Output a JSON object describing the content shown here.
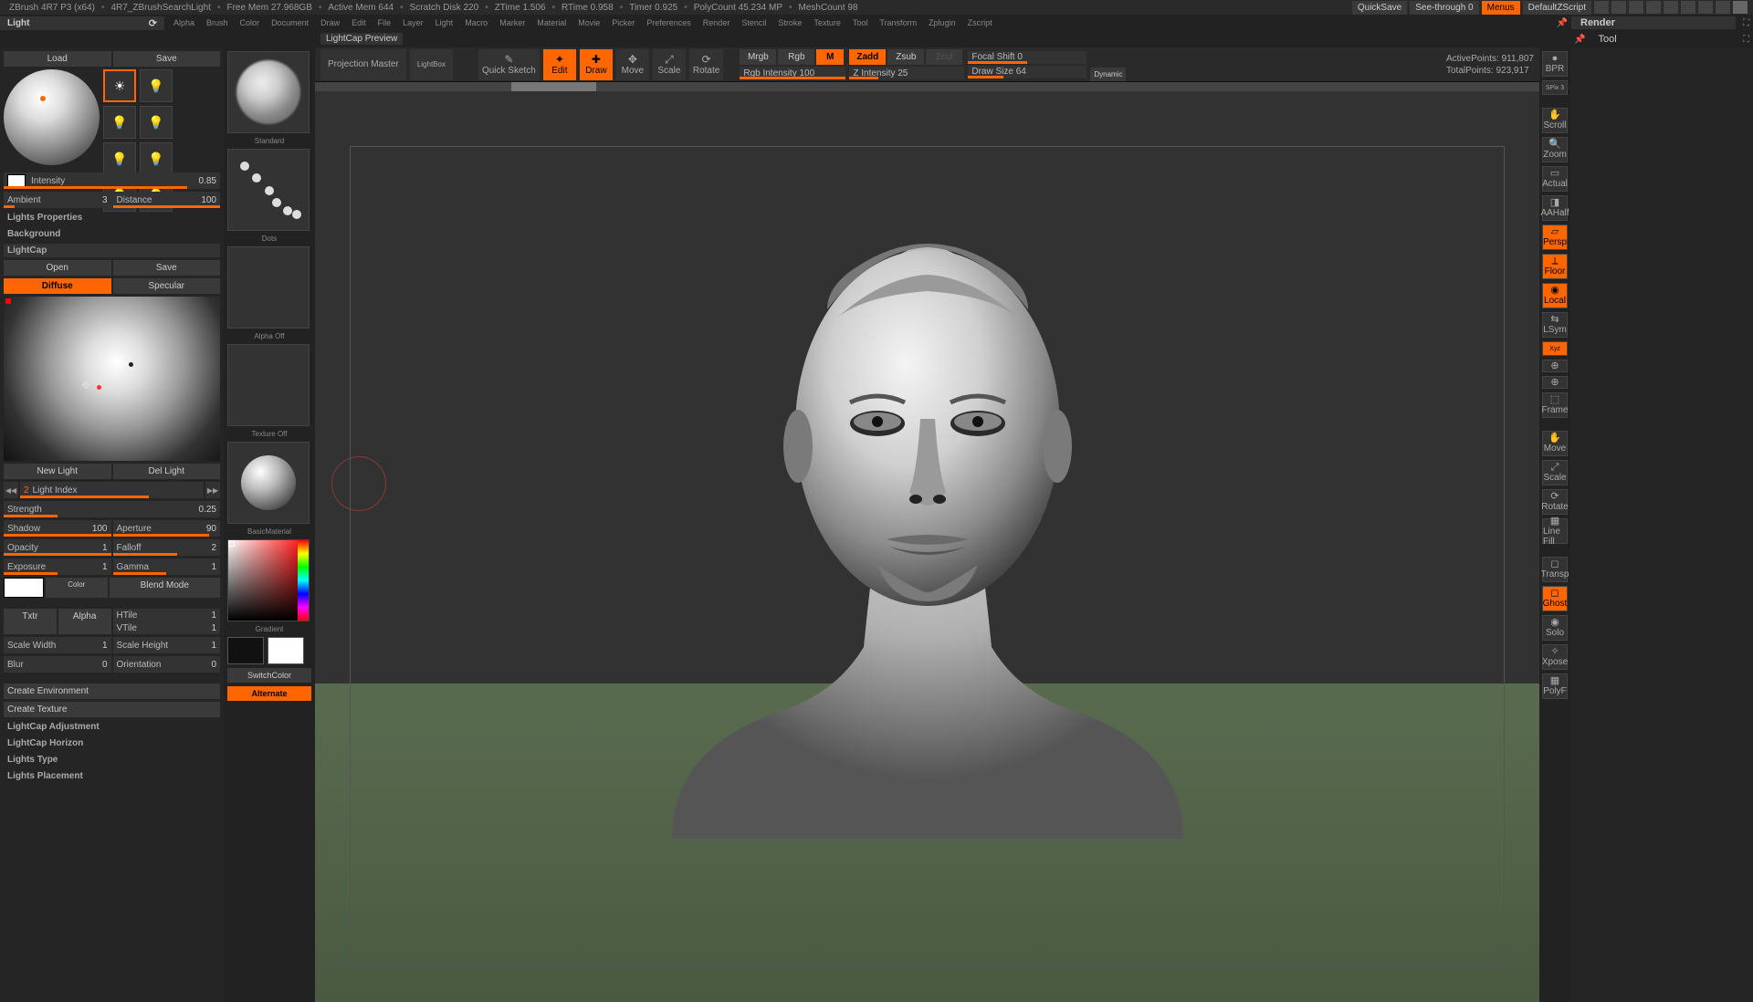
{
  "status": {
    "app": "ZBrush 4R7 P3 (x64)",
    "doc": "4R7_ZBrushSearchLight",
    "freemem": "Free Mem 27.968GB",
    "activemem": "Active Mem 644",
    "scratch": "Scratch Disk 220",
    "ztime": "ZTime 1.506",
    "rtime": "RTime 0.958",
    "timer": "Timer 0.925",
    "polycount": "PolyCount 45.234 MP",
    "meshcount": "MeshCount 98",
    "quicksave": "QuickSave",
    "seethrough": "See-through   0",
    "menus": "Menus",
    "defaultscript": "DefaultZScript"
  },
  "palette_title": "Light",
  "menus": [
    "Alpha",
    "Brush",
    "Color",
    "Document",
    "Draw",
    "Edit",
    "File",
    "Layer",
    "Light",
    "Macro",
    "Marker",
    "Material",
    "Movie",
    "Picker",
    "Preferences",
    "Render",
    "Stencil",
    "Stroke",
    "Texture",
    "Tool",
    "Transform",
    "Zplugin",
    "Zscript"
  ],
  "render": "Render",
  "tool": "Tool",
  "left": {
    "load": "Load",
    "save": "Save",
    "intensity_lab": "Intensity",
    "intensity_val": "0.85",
    "ambient_lab": "Ambient",
    "ambient_val": "3",
    "distance_lab": "Distance",
    "distance_val": "100",
    "lights_props": "Lights Properties",
    "background": "Background",
    "lightcap": "LightCap",
    "open": "Open",
    "lc_save": "Save",
    "diffuse": "Diffuse",
    "specular": "Specular",
    "new_light": "New Light",
    "del_light": "Del Light",
    "light_index_lab": "Light Index",
    "light_index_val": "2",
    "strength_lab": "Strength",
    "strength_val": "0.25",
    "shadow_lab": "Shadow",
    "shadow_val": "100",
    "aperture_lab": "Aperture",
    "aperture_val": "90",
    "opacity_lab": "Opacity",
    "opacity_val": "1",
    "falloff_lab": "Falloff",
    "falloff_val": "2",
    "exposure_lab": "Exposure",
    "exposure_val": "1",
    "gamma_lab": "Gamma",
    "gamma_val": "1",
    "color": "Color",
    "blend": "Blend Mode",
    "txtr": "Txtr",
    "alpha": "Alpha",
    "htile_lab": "HTile",
    "htile_val": "1",
    "vtile_lab": "VTile",
    "vtile_val": "1",
    "scalew_lab": "Scale Width",
    "scalew_val": "1",
    "scaleh_lab": "Scale Height",
    "scaleh_val": "1",
    "blur_lab": "Blur",
    "blur_val": "0",
    "orient_lab": "Orientation",
    "orient_val": "0",
    "create_env": "Create Environment",
    "create_tex": "Create Texture",
    "lc_adjust": "LightCap Adjustment",
    "lc_horizon": "LightCap Horizon",
    "lights_type": "Lights Type",
    "lights_place": "Lights Placement"
  },
  "tray": {
    "brush": "Standard",
    "stroke": "Dots",
    "alpha": "Alpha Off",
    "texture": "Texture Off",
    "material": "BasicMaterial",
    "gradient": "Gradient",
    "switchcolor": "SwitchColor",
    "alternate": "Alternate"
  },
  "topbar": {
    "doc_title": "LightCap Preview",
    "projection": "Projection Master",
    "lightbox": "LightBox",
    "quicksketch": "Quick Sketch",
    "edit": "Edit",
    "draw": "Draw",
    "move": "Move",
    "scale": "Scale",
    "rotate": "Rotate",
    "mrgb": "Mrgb",
    "rgb": "Rgb",
    "m": "M",
    "rgb_int": "Rgb Intensity 100",
    "zadd": "Zadd",
    "zsub": "Zsub",
    "zcut": "Zcut",
    "z_int": "Z Intensity 25",
    "focal": "Focal Shift 0",
    "drawsize": "Draw Size 64",
    "dynamic": "Dynamic",
    "active_pts": "ActivePoints: 911,807",
    "total_pts": "TotalPoints: 923,917"
  },
  "right": {
    "bpr": "BPR",
    "spix": "SPix 3",
    "scroll": "Scroll",
    "zoom": "Zoom",
    "actual": "Actual",
    "aahalf": "AAHalf",
    "persp": "Persp",
    "floor": "Floor",
    "local": "Local",
    "lsym": "LSym",
    "xyz": "Xyz",
    "frame": "Frame",
    "move": "Move",
    "scale": "Scale",
    "rotate": "Rotate",
    "linefill": "Line Fill",
    "transp": "Transp",
    "ghost": "Ghost",
    "solo": "Solo",
    "xpose": "Xpose",
    "polyf": "PolyF"
  }
}
